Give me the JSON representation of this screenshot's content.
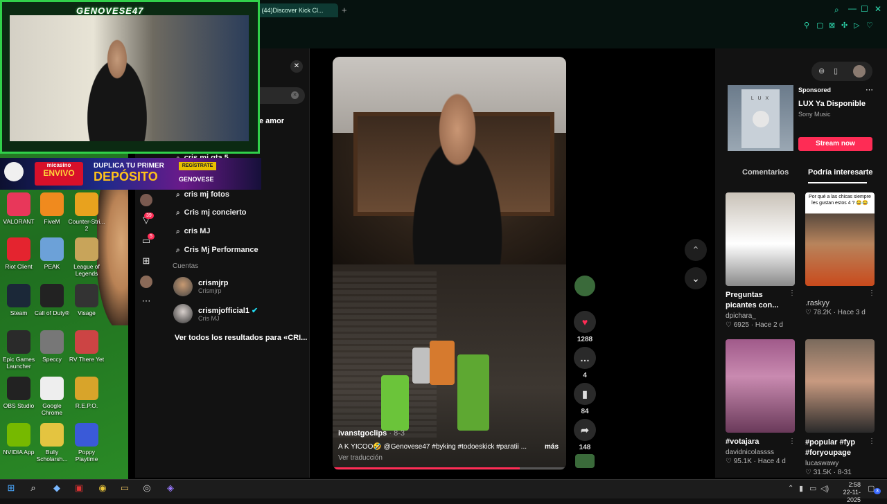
{
  "webcam": {
    "title": "GENOVESE47"
  },
  "banner": {
    "brand": "micasino",
    "line1": "ENVIVO",
    "line2": "DUPLICA TU PRIMER",
    "line3": "DEPÓSITO",
    "cta": "REGÍSTRATE",
    "code": "GENOVESE"
  },
  "desktop": {
    "icons": [
      {
        "label": "VALORANT",
        "icon": "valorant-icon",
        "color": "#e8375a"
      },
      {
        "label": "FiveM",
        "icon": "fivem-icon",
        "color": "#f08a1e"
      },
      {
        "label": "Counter-Stri... 2",
        "icon": "cs2-icon",
        "color": "#e8a21e"
      },
      {
        "label": "Riot Client",
        "icon": "riot-icon",
        "color": "#e4242f"
      },
      {
        "label": "PEAK",
        "icon": "peak-icon",
        "color": "#6ca1d8"
      },
      {
        "label": "League of Legends",
        "icon": "lol-icon",
        "color": "#c8a45a"
      },
      {
        "label": "Steam",
        "icon": "steam-icon",
        "color": "#1b2838"
      },
      {
        "label": "Call of Duty®",
        "icon": "cod-icon",
        "color": "#222"
      },
      {
        "label": "Visage",
        "icon": "visage-icon",
        "color": "#333"
      },
      {
        "label": "Epic Games Launcher",
        "icon": "epic-icon",
        "color": "#2a2a2a"
      },
      {
        "label": "Speccy",
        "icon": "speccy-icon",
        "color": "#777"
      },
      {
        "label": "RV There Yet",
        "icon": "rv-icon",
        "color": "#c44"
      },
      {
        "label": "OBS Studio",
        "icon": "obs-icon",
        "color": "#222"
      },
      {
        "label": "Google Chrome",
        "icon": "chrome-icon",
        "color": "#eee"
      },
      {
        "label": "R.E.P.O.",
        "icon": "repo-icon",
        "color": "#d8a42a"
      },
      {
        "label": "NVIDIA App",
        "icon": "nvidia-icon",
        "color": "#76b900"
      },
      {
        "label": "Bully Scholarsh...",
        "icon": "bully-icon",
        "color": "#e4c440"
      },
      {
        "label": "Poppy Playtime",
        "icon": "poppy-icon",
        "color": "#3a5ad8"
      }
    ]
  },
  "browser": {
    "tab_label": "(44)Discover Kick Cl..."
  },
  "nav": {
    "badge_inbox": "39",
    "badge_messages": "5"
  },
  "search": {
    "partial_suggestion": "e amor",
    "suggestions": [
      {
        "label": "cris mj gta 5"
      },
      {
        "label": "cris mj fotos"
      },
      {
        "label": "Cris mj concierto"
      },
      {
        "label": "cris MJ"
      },
      {
        "label": "Cris Mj Performance"
      }
    ],
    "accounts_header": "Cuentas",
    "accounts": [
      {
        "name": "crismjrp",
        "handle": "Crismjrp"
      },
      {
        "name": "crismjofficial1",
        "handle": "Cris MJ"
      }
    ],
    "see_all": "Ver todos los resultados para «CRI..."
  },
  "video": {
    "author": "ivanstgoclips",
    "date": "8-3",
    "caption": "A K YICOO🤣 @Genovese47 #byking #todoeskick #paratii ...",
    "more": "más",
    "translate": "Ver traducción",
    "progress": 0.8
  },
  "actions": {
    "likes": "1288",
    "comments": "4",
    "saves": "84",
    "shares": "148"
  },
  "ad": {
    "sponsored": "Sponsored",
    "title": "LUX Ya Disponible",
    "sub": "Sony Music",
    "cta": "Stream now",
    "cover_text": "L U X"
  },
  "right_tabs": {
    "comments": "Comentarios",
    "suggested": "Podría interesarte"
  },
  "cards": [
    {
      "title": "Preguntas picantes con...",
      "user": "dpichara_",
      "likes": "6925",
      "age": "Hace 2 d"
    },
    {
      "title": ".raskyy",
      "user": "",
      "likes": "78.2K",
      "age": "Hace 3 d",
      "overlay": "Por qué a las chicas siempre les gustan estos 4 ? 😂😂"
    },
    {
      "title": "#votajara",
      "user": "davidnicolassss",
      "likes": "95.1K",
      "age": "Hace 4 d"
    },
    {
      "title": "#popular #fyp #foryoupage",
      "user": "lucaswawy",
      "likes": "31.5K",
      "age": "8-31"
    }
  ],
  "taskbar": {
    "time": "2:58",
    "date": "22-11-2025",
    "notif": "3"
  }
}
